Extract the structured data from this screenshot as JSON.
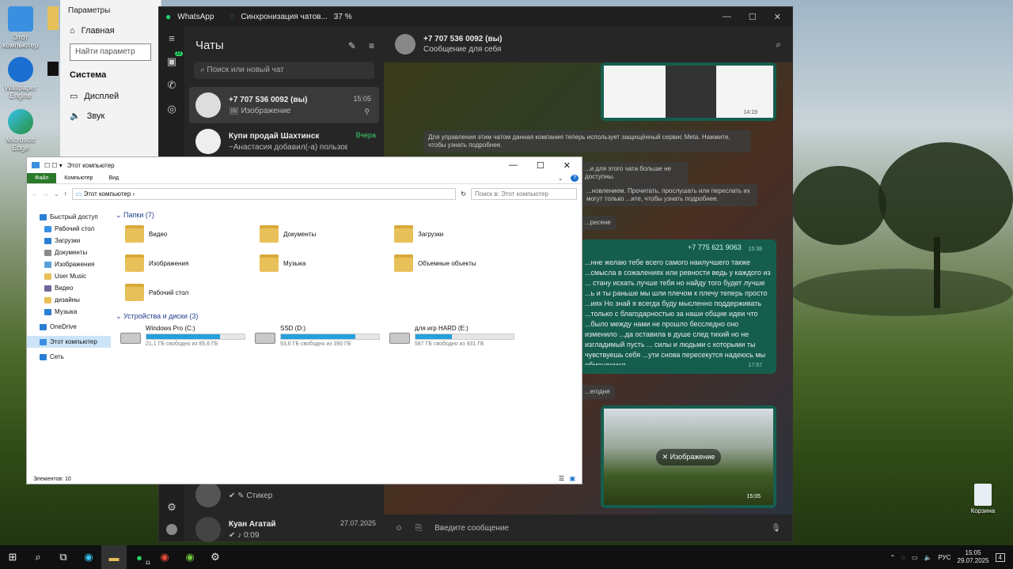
{
  "desktop": {
    "icons": [
      {
        "label": "Этот компьютер"
      },
      {
        "label": "Wallpaper Engine"
      },
      {
        "label": "Microsoft Edge"
      }
    ],
    "recycle_label": "Корзина"
  },
  "settings": {
    "title": "Параметры",
    "home": "Главная",
    "search_placeholder": "Найти параметр",
    "section": "Система",
    "items": [
      "Дисплей",
      "Звук"
    ]
  },
  "whatsapp": {
    "app_name": "WhatsApp",
    "sync_text": "Синхронизация чатов...",
    "sync_percent": "37 %",
    "list_title": "Чаты",
    "search_placeholder": "Поиск или новый чат",
    "rail_badge": "11",
    "chats": [
      {
        "name": "+7 707 536 0092 (вы)",
        "preview": "Изображение",
        "time": "15:05"
      },
      {
        "name": "Купи продай Шахтинск",
        "preview": "~Анастасия добавил(-а) пользов...",
        "time": "Вчера"
      },
      {
        "name": "",
        "preview": "Стикер",
        "time": ""
      },
      {
        "name": "Куан Агатай",
        "preview": "0:09",
        "time": "27.07.2025"
      }
    ],
    "header_name": "+7 707 536 0092 (вы)",
    "header_sub": "Сообщение для себя",
    "sys_msg_1": "Для управления этим чатом данная компания теперь использует защищённый сервис Meta. Нажмите, чтобы узнать подробнее.",
    "sys_msg_2": "...и для этого чата больше не доступны.",
    "sys_msg_3": "...новлением. Прочитать, прослушать или переслать их могут только ...ите, чтобы узнать подробнее.",
    "date_chip_1": "...ресене",
    "date_chip_2": "...егодня",
    "img_time_1": "14:19",
    "fwd_sender": "+7 775 621 9063",
    "fwd_time": "15:38",
    "fwd_text": "...нне желаю тебе всего самого наилучшего также ...смысла в сожалениях или ревности ведь у каждого из ... стану искать лучше тебя но найду того будет лучше ...ь и ты раньше мы шли плечом к плечу теперь просто ...иях Но знай я всегда буду мысленно поддерживать ...только с благодарностью за наши общие идеи что ...было между нами не прошло бесследно оно изменило ...да оставила в душе след тихий но не изгладимый пусть ... силы и людьми с которыми ты чувствуешь себя ...ути снова пересекутся надеюсь мы обменяемся",
    "fwd_msg_time": "17:57",
    "image_label": "Изображение",
    "img_time_2": "15:05",
    "composer_placeholder": "Введите сообщение"
  },
  "explorer": {
    "title": "Этот компьютер",
    "tabs": [
      "Файл",
      "Компьютер",
      "Вид"
    ],
    "address": "Этот компьютер",
    "search_placeholder": "Поиск в: Этот компьютер",
    "nav": [
      {
        "label": "Быстрый доступ",
        "color": "#2a7fd4",
        "sub": false
      },
      {
        "label": "Рабочий стол",
        "color": "#3a8fe0",
        "sub": true
      },
      {
        "label": "Загрузки",
        "color": "#2a7fd4",
        "sub": true
      },
      {
        "label": "Документы",
        "color": "#8a8a8a",
        "sub": true
      },
      {
        "label": "Изображения",
        "color": "#5aa0d8",
        "sub": true
      },
      {
        "label": "User Music",
        "color": "#e8c05a",
        "sub": true
      },
      {
        "label": "Видео",
        "color": "#6a6a9a",
        "sub": true
      },
      {
        "label": "дизайны",
        "color": "#e8c05a",
        "sub": true
      },
      {
        "label": "Музыка",
        "color": "#2a7fd4",
        "sub": true
      },
      {
        "label": "OneDrive",
        "color": "#2a7fd4",
        "sub": false
      },
      {
        "label": "Этот компьютер",
        "color": "#3a8fe0",
        "sub": false
      },
      {
        "label": "Сеть",
        "color": "#2a7fd4",
        "sub": false
      }
    ],
    "folders_header": "Папки (7)",
    "folders": [
      "Видео",
      "Документы",
      "Загрузки",
      "Изображения",
      "Музыка",
      "Объемные объекты",
      "Рабочий стол"
    ],
    "drives_header": "Устройства и диски (3)",
    "drives": [
      {
        "name": "Windows Pro  (C:)",
        "free": "21,1 ГБ свободно из 85,6 ГБ",
        "used_fraction": 0.75
      },
      {
        "name": "SSD (D:)",
        "free": "93,6 ГБ свободно из 390 ГБ",
        "used_fraction": 0.76
      },
      {
        "name": "для игр HARD (E:)",
        "free": "587 ГБ свободно из 931 ГБ",
        "used_fraction": 0.37
      }
    ],
    "status": "Элементов: 10"
  },
  "taskbar": {
    "language": "РУС",
    "time": "15:05",
    "date": "29.07.2025",
    "notif_count": "4",
    "wa_badge": "11"
  }
}
